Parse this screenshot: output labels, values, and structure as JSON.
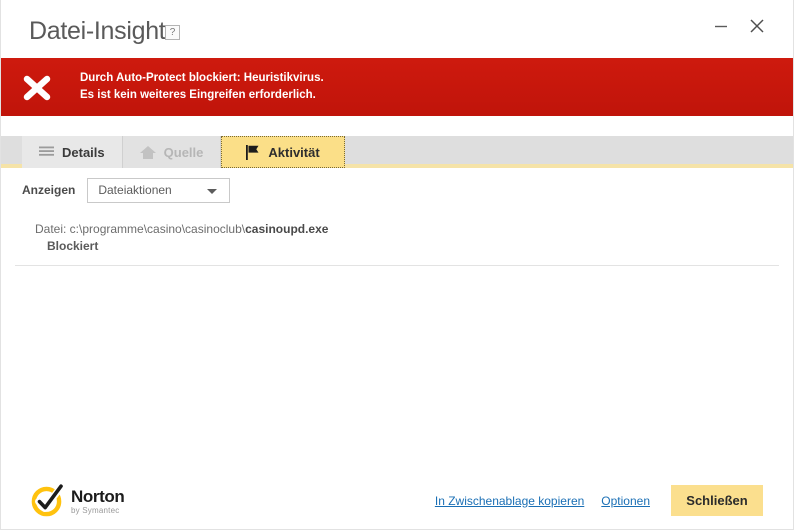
{
  "window": {
    "title": "Datei-Insight",
    "help_icon_label": "?",
    "minimize_label": "Minimieren",
    "close_label": "Schließen"
  },
  "alert": {
    "icon": "x-mark-icon",
    "line1": "Durch Auto-Protect blockiert: Heuristikvirus.",
    "line2": "Es ist kein weiteres Eingreifen erforderlich.",
    "background_color": "#c8160b"
  },
  "tabs": [
    {
      "label": "Details",
      "icon": "list-lines-icon",
      "state": "normal"
    },
    {
      "label": "Quelle",
      "icon": "home-icon",
      "state": "disabled"
    },
    {
      "label": "Aktivität",
      "icon": "flag-icon",
      "state": "active"
    }
  ],
  "filter": {
    "label": "Anzeigen",
    "selected": "Dateiaktionen",
    "options": [
      "Dateiaktionen"
    ]
  },
  "activity": {
    "entries": [
      {
        "prefix": "Datei: c:\\programme\\casino\\casinoclub\\",
        "filename": "casinoupd.exe",
        "status": "Blockiert"
      }
    ]
  },
  "footer": {
    "brand_name": "Norton",
    "brand_sub": "by Symantec",
    "brand_icon": "norton-checkmark-icon",
    "copy_link": "In Zwischenablage kopieren",
    "options_link": "Optionen",
    "close_button": "Schließen",
    "accent_color": "#fbdf8e",
    "link_color": "#1a6fb5"
  }
}
